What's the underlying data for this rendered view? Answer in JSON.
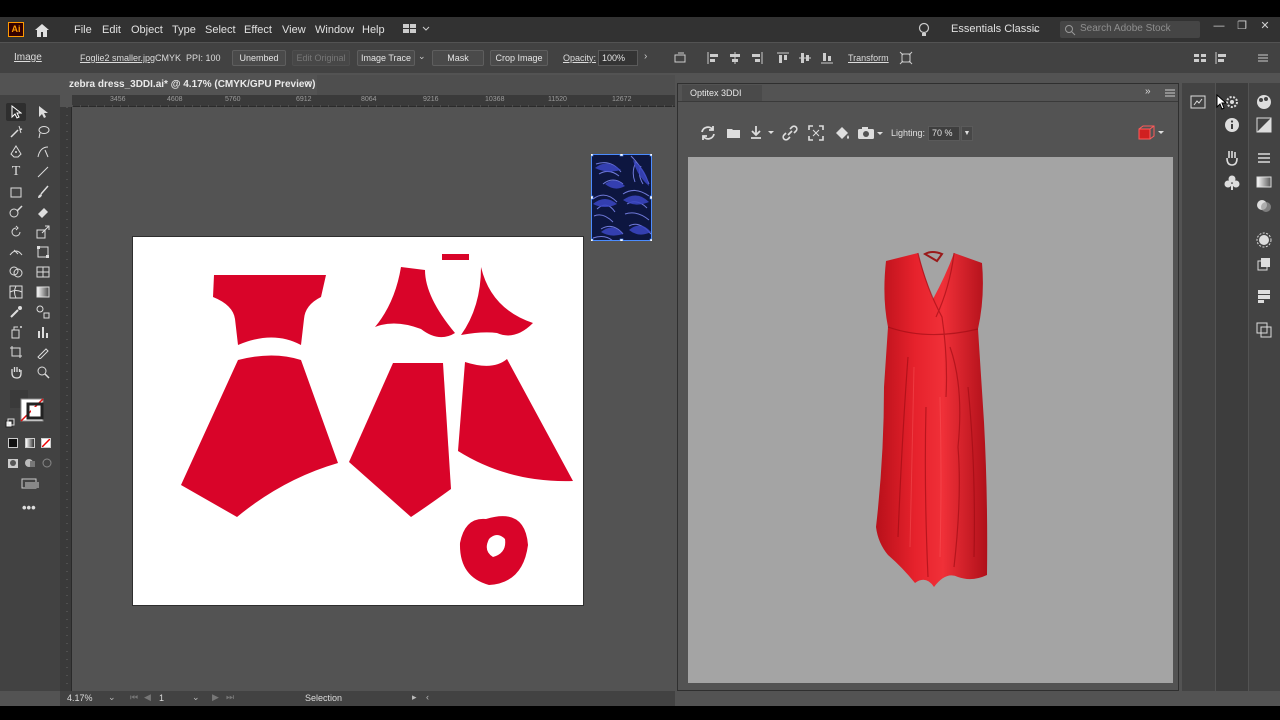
{
  "app": {
    "logo": "Ai"
  },
  "menu": [
    "File",
    "Edit",
    "Object",
    "Type",
    "Select",
    "Effect",
    "View",
    "Window",
    "Help"
  ],
  "workspace": {
    "label": "Essentials Classic",
    "search_placeholder": "Search Adobe Stock"
  },
  "control_bar": {
    "selection_type": "Image",
    "file_name": "Foglie2 smaller.jpg",
    "color_mode": "CMYK",
    "ppi": "PPI: 100",
    "unembed": "Unembed",
    "edit_original": "Edit Original",
    "image_trace": "Image Trace",
    "mask": "Mask",
    "crop_image": "Crop Image",
    "opacity_label": "Opacity:",
    "opacity_value": "100%",
    "transform": "Transform"
  },
  "document": {
    "tab_title": "zebra dress_3DDI.ai* @ 4.17% (CMYK/GPU Preview)",
    "close": "×"
  },
  "ruler": {
    "h_ticks": [
      "3456",
      "4608",
      "5760",
      "6912",
      "8064",
      "9216",
      "10368",
      "11520",
      "12672"
    ]
  },
  "status": {
    "zoom": "4.17%",
    "page": "1",
    "mode": "Selection"
  },
  "panel_3ddi": {
    "title": "Optitex 3DDI",
    "lighting_label": "Lighting:",
    "lighting_value": "70 %"
  },
  "colors": {
    "pattern_red": "#d90429",
    "dress_red": "#e0202a",
    "swatch_blue": "#3b47c4",
    "ui_dark": "#323232"
  }
}
